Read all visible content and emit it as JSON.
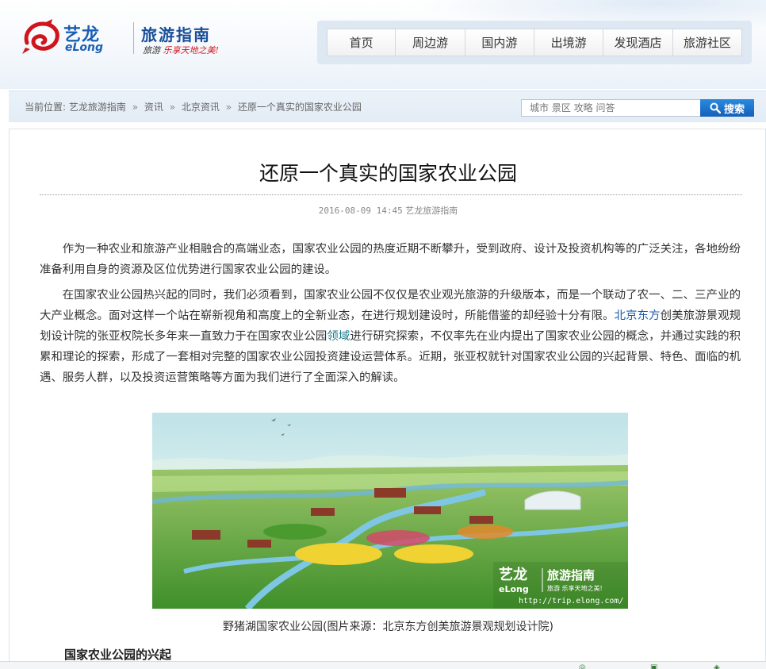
{
  "brand": {
    "name_cn": "艺龙",
    "name_en": "eLong",
    "section": "旅游指南",
    "slogan_a": "旅游",
    "slogan_b": "乐享天地之美!"
  },
  "nav": {
    "items": [
      "首页",
      "周边游",
      "国内游",
      "出境游",
      "发现酒店",
      "旅游社区"
    ]
  },
  "breadcrumb": {
    "prefix": "当前位置:",
    "items": [
      "艺龙旅游指南",
      "资讯",
      "北京资讯",
      "还原一个真实的国家农业公园"
    ],
    "separator": "»"
  },
  "search": {
    "placeholder": "城市 景区 攻略 问答",
    "button_label": "搜索"
  },
  "article": {
    "title": "还原一个真实的国家农业公园",
    "date": "2016-08-09 14:45",
    "source": "艺龙旅游指南",
    "p1": "作为一种农业和旅游产业相融合的高端业态，国家农业公园的热度近期不断攀升，受到政府、设计及投资机构等的广泛关注，各地纷纷准备利用自身的资源及区位优势进行国家农业公园的建设。",
    "p2_a": "在国家农业公园热兴起的同时，我们必须看到，国家农业公园不仅仅是农业观光旅游的升级版本，而是一个联动了农一、二、三产业的大产业概念。面对这样一个站在崭新视角和高度上的全新业态，在进行规划建设时，所能借鉴的却经验十分有限。",
    "p2_link1": "北京东方",
    "p2_b": "创美旅游景观规划设计院的张亚权院长多年来一直致力于在国家农业公园",
    "p2_link2": "领域",
    "p2_c": "进行研究探索，不仅率先在业内提出了国家农业公园的概念，并通过实践的积累和理论的探索，形成了一套相对完整的国家农业公园投资建设运营体系。近期，张亚权就针对国家农业公园的兴起背景、特色、面临的机遇、服务人群，以及投资运营策略等方面为我们进行了全面深入的解读。",
    "image_watermark_cn": "艺龙",
    "image_watermark_en": "eLong",
    "image_watermark_section": "旅游指南",
    "image_watermark_slogan": "旅游 乐享天地之美!",
    "image_watermark_url": "http://trip.elong.com/",
    "image_caption": "野猪湖国家农业公园(图片来源：北京东方创美旅游景观规划设计院)",
    "subheading": "国家农业公园的兴起"
  },
  "colors": {
    "brand_blue": "#1a5fb4",
    "brand_red": "#d0141d",
    "link_blue": "#1c5ca8",
    "search_button": "#1f74cc"
  }
}
